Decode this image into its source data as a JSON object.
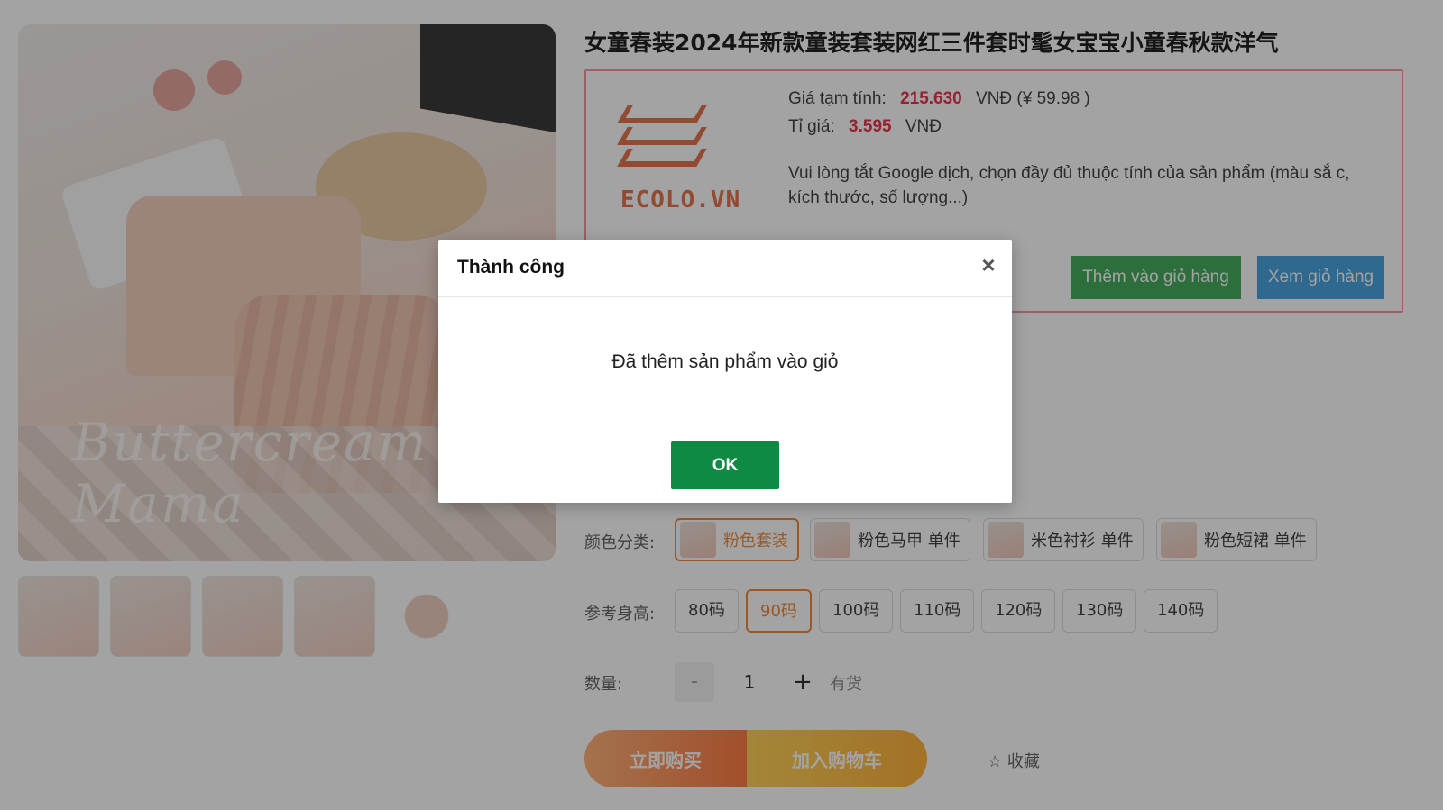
{
  "product": {
    "title": "女童春装2024年新款童装套装网红三件套时髦女宝宝小童春秋款洋气"
  },
  "price_box": {
    "logo_text": "ECOLO.VN",
    "price_label": "Giá tạm tính:",
    "price_value": "215.630",
    "price_unit": "VNĐ (¥ 59.98 )",
    "rate_label": "Tỉ giá:",
    "rate_value": "3.595",
    "rate_unit": "VNĐ",
    "note": "Vui lòng tắt Google dịch, chọn đầy đủ thuộc tính của sản phẩm (màu sắ c, kích thước, số lượng...)",
    "add_to_cart_label": "Thêm vào giỏ hàng",
    "view_cart_label": "Xem giỏ hàng"
  },
  "options": {
    "color_label": "颜色分类:",
    "colors": [
      "粉色套装",
      "粉色马甲 单件",
      "米色衬衫 单件",
      "粉色短裙 单件"
    ],
    "selected_color": "粉色套装",
    "size_label": "参考身高:",
    "sizes": [
      "80码",
      "90码",
      "100码",
      "110码",
      "120码",
      "130码",
      "140码"
    ],
    "selected_size": "90码",
    "quantity_label": "数量:",
    "quantity_value": "1",
    "quantity_minus": "-",
    "quantity_plus": "+",
    "stock_status": "有货"
  },
  "actions": {
    "buy_now_label": "立即购买",
    "add_cart_label": "加入购物车",
    "favorite_label": "☆ 收藏"
  },
  "modal": {
    "title": "Thành công",
    "close_symbol": "×",
    "message": "Đã thêm sản phẩm vào giỏ",
    "ok_label": "OK"
  },
  "colors": {
    "accent_red": "#e8364b",
    "primary_green": "#0e8a44",
    "add_green": "#46ad5e",
    "view_blue": "#4aa5e0",
    "logo_orange": "#e5744e",
    "selected_orange": "#f08a3c"
  }
}
